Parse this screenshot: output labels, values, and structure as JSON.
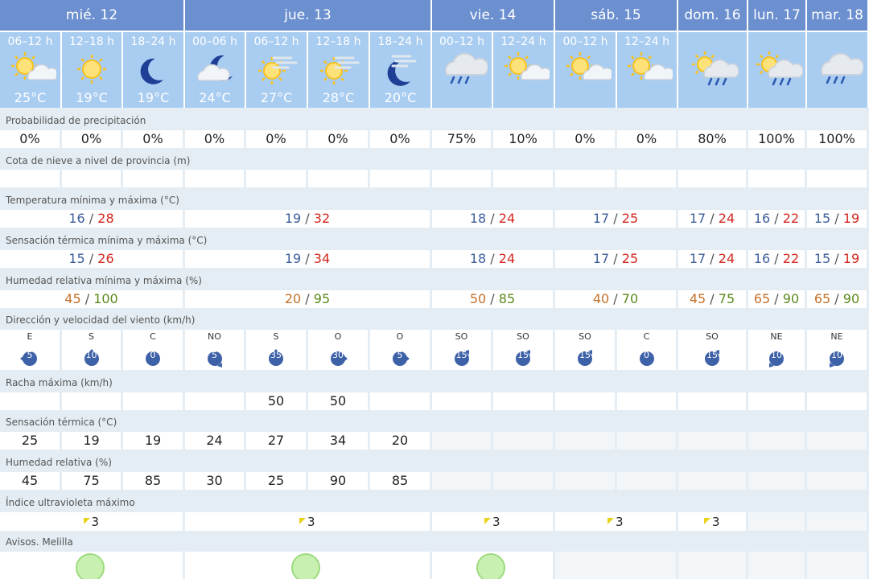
{
  "days": [
    {
      "label": "mié. 12",
      "periods": 3
    },
    {
      "label": "jue. 13",
      "periods": 4
    },
    {
      "label": "vie. 14",
      "periods": 2
    },
    {
      "label": "sáb. 15",
      "periods": 2
    },
    {
      "label": "dom. 16",
      "periods": 1
    },
    {
      "label": "lun. 17",
      "periods": 1
    },
    {
      "label": "mar. 18",
      "periods": 1
    }
  ],
  "periods": [
    {
      "time": "06–12 h",
      "icon": "sun-cloud-icon",
      "temp": "25°C"
    },
    {
      "time": "12–18 h",
      "icon": "sun-icon",
      "temp": "19°C"
    },
    {
      "time": "18–24 h",
      "icon": "moon-icon",
      "temp": "19°C"
    },
    {
      "time": "00–06 h",
      "icon": "moon-cloud-icon",
      "temp": "24°C"
    },
    {
      "time": "06–12 h",
      "icon": "sun-haze-icon",
      "temp": "27°C"
    },
    {
      "time": "12–18 h",
      "icon": "sun-haze-icon",
      "temp": "28°C"
    },
    {
      "time": "18–24 h",
      "icon": "moon-haze-icon",
      "temp": "20°C"
    },
    {
      "time": "00–12 h",
      "icon": "cloud-rain-icon",
      "temp": ""
    },
    {
      "time": "12–24 h",
      "icon": "sun-cloud-icon",
      "temp": ""
    },
    {
      "time": "00–12 h",
      "icon": "sun-cloud-icon",
      "temp": ""
    },
    {
      "time": "12–24 h",
      "icon": "sun-cloud-icon",
      "temp": ""
    },
    {
      "time": "",
      "icon": "sun-cloud-rain-icon",
      "temp": ""
    },
    {
      "time": "",
      "icon": "sun-cloud-rain-icon",
      "temp": ""
    },
    {
      "time": "",
      "icon": "cloud-rain-icon",
      "temp": ""
    }
  ],
  "labels": {
    "precip": "Probabilidad de precipitación",
    "snow": "Cota de nieve a nivel de provincia (m)",
    "temp": "Temperatura mínima y máxima (°C)",
    "feels": "Sensación térmica mínima y máxima (°C)",
    "hum": "Humedad relativa mínima y máxima (%)",
    "wind": "Dirección y velocidad del viento (km/h)",
    "gust": "Racha máxima (km/h)",
    "feels_hourly": "Sensación térmica (°C)",
    "hum_hourly": "Humedad relativa (%)",
    "uv": "Índice ultravioleta máximo",
    "alerts": "Avisos. Melilla"
  },
  "precip": [
    "0%",
    "0%",
    "0%",
    "0%",
    "0%",
    "0%",
    "0%",
    "75%",
    "10%",
    "0%",
    "0%",
    "80%",
    "100%",
    "100%"
  ],
  "temp_range": [
    {
      "min": "16",
      "max": "28"
    },
    {
      "min": "19",
      "max": "32"
    },
    {
      "min": "18",
      "max": "24"
    },
    {
      "min": "17",
      "max": "25"
    },
    {
      "min": "17",
      "max": "24"
    },
    {
      "min": "16",
      "max": "22"
    },
    {
      "min": "15",
      "max": "19"
    }
  ],
  "feels_range": [
    {
      "min": "15",
      "max": "26"
    },
    {
      "min": "19",
      "max": "34"
    },
    {
      "min": "18",
      "max": "24"
    },
    {
      "min": "17",
      "max": "25"
    },
    {
      "min": "17",
      "max": "24"
    },
    {
      "min": "16",
      "max": "22"
    },
    {
      "min": "15",
      "max": "19"
    }
  ],
  "hum_range": [
    {
      "min": "45",
      "max": "100"
    },
    {
      "min": "20",
      "max": "95"
    },
    {
      "min": "50",
      "max": "85"
    },
    {
      "min": "40",
      "max": "70"
    },
    {
      "min": "45",
      "max": "75"
    },
    {
      "min": "65",
      "max": "90"
    },
    {
      "min": "65",
      "max": "90"
    }
  ],
  "wind": [
    {
      "dir": "E",
      "speed": "5"
    },
    {
      "dir": "S",
      "speed": "10"
    },
    {
      "dir": "C",
      "speed": "0"
    },
    {
      "dir": "NO",
      "speed": "5"
    },
    {
      "dir": "S",
      "speed": "35"
    },
    {
      "dir": "O",
      "speed": "30"
    },
    {
      "dir": "O",
      "speed": "5"
    },
    {
      "dir": "SO",
      "speed": "15"
    },
    {
      "dir": "SO",
      "speed": "15"
    },
    {
      "dir": "SO",
      "speed": "15"
    },
    {
      "dir": "C",
      "speed": "0"
    },
    {
      "dir": "SO",
      "speed": "15"
    },
    {
      "dir": "NE",
      "speed": "10"
    },
    {
      "dir": "NE",
      "speed": "10"
    }
  ],
  "gust": [
    "",
    "",
    "",
    "",
    "50",
    "50",
    "",
    "",
    "",
    "",
    "",
    "",
    "",
    ""
  ],
  "feels_hourly": [
    "25",
    "19",
    "19",
    "24",
    "27",
    "34",
    "20"
  ],
  "hum_hourly": [
    "45",
    "75",
    "85",
    "30",
    "25",
    "90",
    "85"
  ],
  "uv": [
    "3",
    "3",
    "3",
    "3",
    "3",
    "",
    ""
  ],
  "alerts": [
    true,
    true,
    true,
    false,
    false,
    false,
    false
  ],
  "colors": {
    "header": "#6b8fcf",
    "subheader": "#a9ccf1",
    "background": "#e4edf3",
    "min": "#3c5f9c",
    "max": "#d3271f",
    "wind_badge": "#3e62a8",
    "alert_green": "#c8f0b0"
  }
}
